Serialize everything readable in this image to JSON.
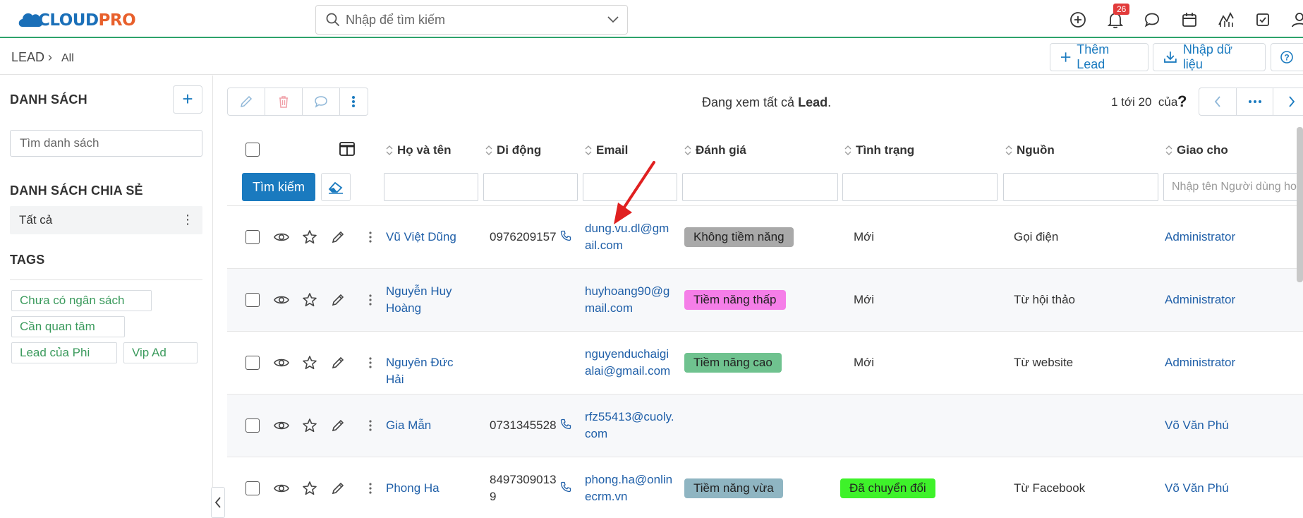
{
  "header": {
    "logo_main": "CLOUD",
    "logo_accent": "PRO",
    "search_placeholder": "Nhập để tìm kiếm",
    "notification_count": "26"
  },
  "breadcrumb": {
    "module": "LEAD",
    "view": "All"
  },
  "actions": {
    "add_lead": "Thêm Lead",
    "import_data": "Nhập dữ liệu"
  },
  "sidebar": {
    "list_title": "DANH SÁCH",
    "list_search_placeholder": "Tìm danh sách",
    "shared_title": "DANH SÁCH CHIA SẺ",
    "shared_items": [
      "Tất cả"
    ],
    "tags_title": "TAGS",
    "tags": [
      "Chưa có ngân sách",
      "Cần quan tâm",
      "Lead của Phi",
      "Vip Ad"
    ]
  },
  "main": {
    "viewing_prefix": "Đang xem tất cả",
    "viewing_entity": "Lead",
    "viewing_suffix": ".",
    "pager_text": "1 tới 20  của",
    "pager_unknown": "?"
  },
  "table": {
    "columns": [
      "Họ và tên",
      "Di động",
      "Email",
      "Đánh giá",
      "Tình trạng",
      "Nguồn",
      "Giao cho"
    ],
    "search_button": "Tìm kiếm",
    "assignee_filter_placeholder": "Nhập tên Người dùng hoặc Nhóm",
    "rows": [
      {
        "name": [
          "Vũ Việt Dũng"
        ],
        "mobile": [
          "0976209157"
        ],
        "email": [
          "dung.vu.dl@gm",
          "ail.com"
        ],
        "rating": "Không tiềm năng",
        "status": "Mới",
        "source": "Gọi điện",
        "assignee": "Administrator"
      },
      {
        "name": [
          "Nguyễn Huy",
          "Hoàng"
        ],
        "mobile": [],
        "email": [
          "huyhoang90@g",
          "mail.com"
        ],
        "rating": "Tiềm năng thấp",
        "status": "Mới",
        "source": "Từ hội thảo",
        "assignee": "Administrator"
      },
      {
        "name": [
          "Nguyên Đức Hải"
        ],
        "mobile": [],
        "email": [
          "nguyenduchaigi",
          "alai@gmail.com"
        ],
        "rating": "Tiềm năng cao",
        "status": "Mới",
        "source": "Từ website",
        "assignee": "Administrator"
      },
      {
        "name": [
          "Gia Mẫn"
        ],
        "mobile": [
          "0731345528"
        ],
        "email": [
          "rfz55413@cuoly.",
          "com"
        ],
        "rating": "",
        "status": "",
        "source": "",
        "assignee": "Võ Văn Phú"
      },
      {
        "name": [
          "Phong Ha"
        ],
        "mobile": [
          "8497309013",
          "9"
        ],
        "email": [
          "phong.ha@onlin",
          "ecrm.vn"
        ],
        "rating": "Tiềm năng vừa",
        "status": "Đã chuyển đổi",
        "source": "Từ Facebook",
        "assignee": "Võ Văn Phú"
      }
    ]
  },
  "colors": {
    "accent": "#1a7abf",
    "link": "#1f5fa8",
    "tag_text": "#3a9a5c",
    "rating_none": "#a9a9a9",
    "rating_low": "#f57ee8",
    "rating_high": "#6fc28f",
    "rating_mid": "#8fb5c2",
    "status_converted": "#3ef22a",
    "annotation_arrow": "#e02020"
  },
  "icons": [
    "search-icon",
    "chevron-down-icon",
    "add-circle-icon",
    "bell-icon",
    "chat-icon",
    "calendar-icon",
    "chart-icon",
    "task-icon",
    "user-icon",
    "plus-icon",
    "download-icon",
    "help-icon",
    "edit-icon",
    "trash-icon",
    "comment-icon",
    "more-vertical-icon",
    "eye-icon",
    "star-icon",
    "phone-icon",
    "eraser-icon",
    "columns-icon",
    "sort-icon"
  ]
}
